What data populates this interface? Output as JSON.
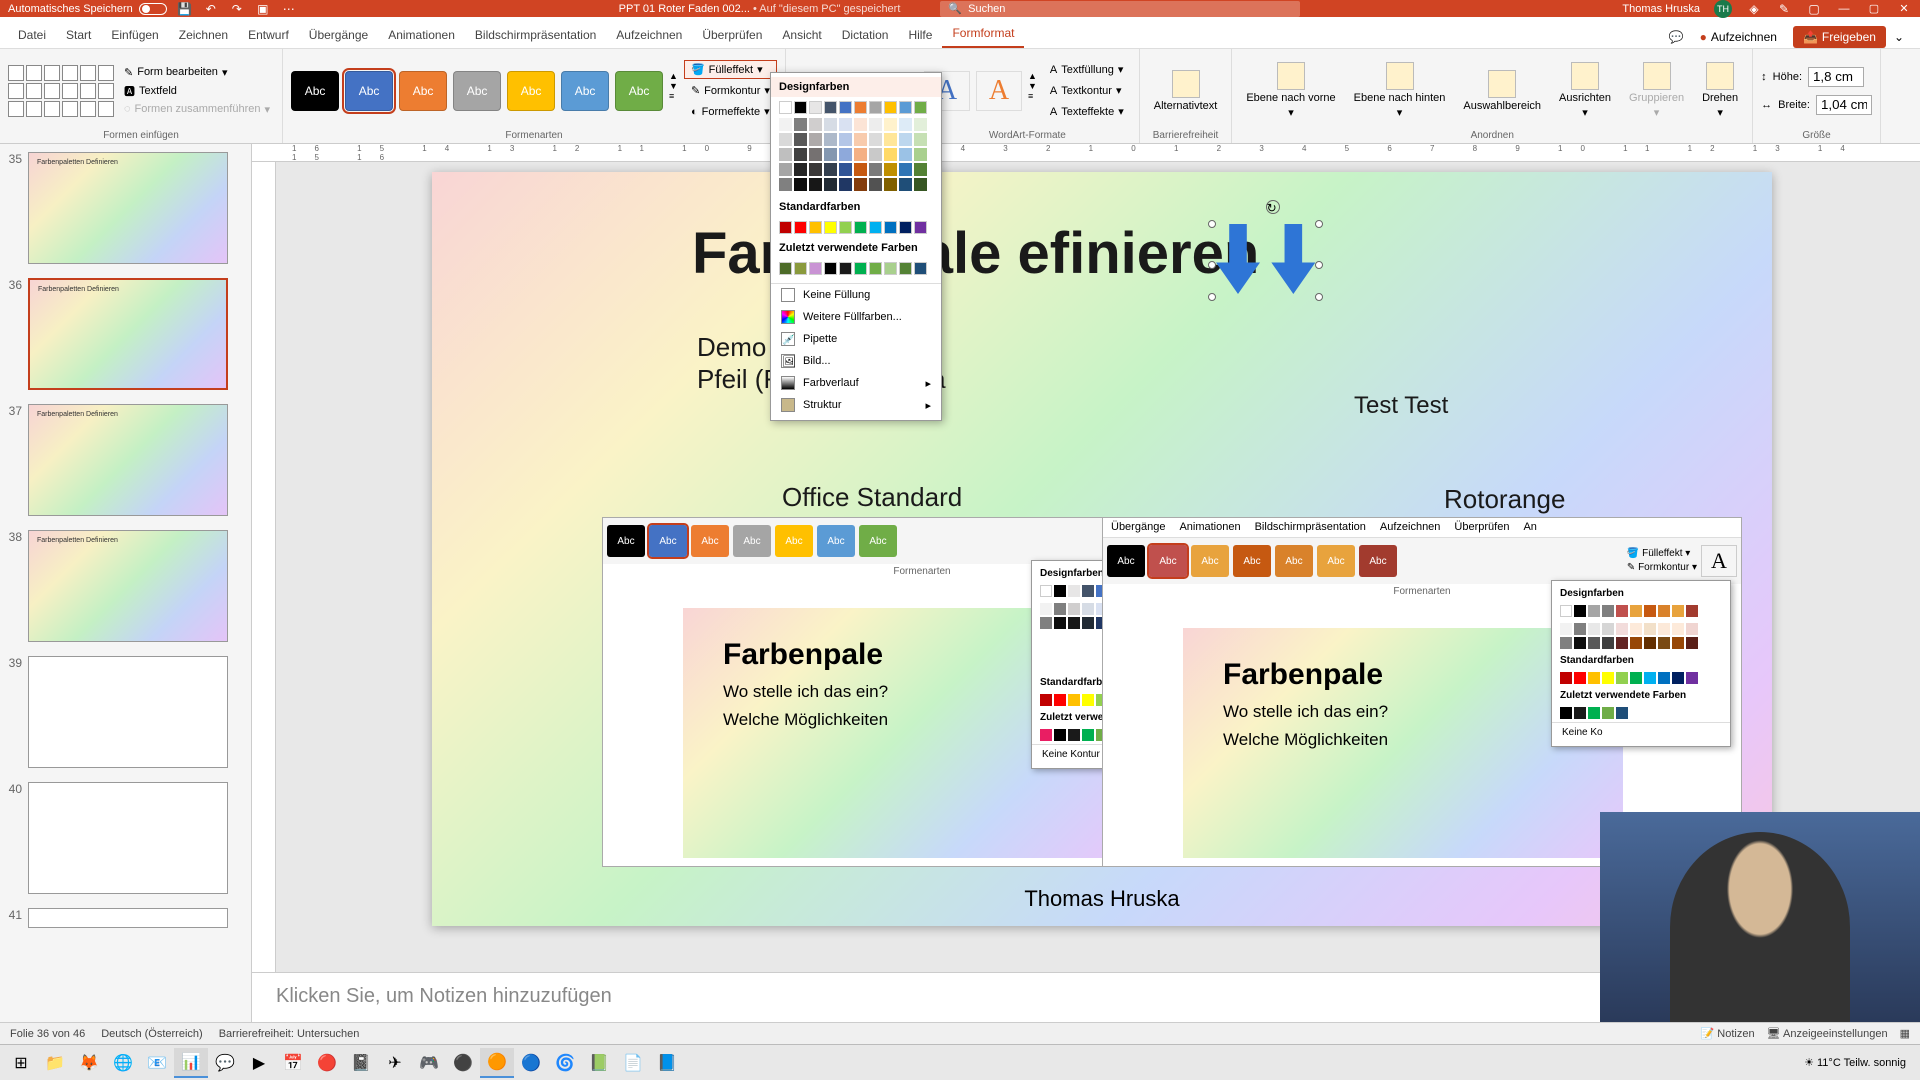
{
  "titlebar": {
    "autosave": "Automatisches Speichern",
    "doc_name": "PPT 01 Roter Faden 002...",
    "saved_hint": "• Auf \"diesem PC\" gespeichert",
    "search_placeholder": "Suchen",
    "user_name": "Thomas Hruska",
    "user_initials": "TH"
  },
  "tabs": {
    "items": [
      "Datei",
      "Start",
      "Einfügen",
      "Zeichnen",
      "Entwurf",
      "Übergänge",
      "Animationen",
      "Bildschirmpräsentation",
      "Aufzeichnen",
      "Überprüfen",
      "Ansicht",
      "Dictation",
      "Hilfe",
      "Formformat"
    ],
    "active": "Formformat",
    "record": "Aufzeichnen",
    "share": "Freigeben"
  },
  "ribbon": {
    "g_shapes": "Formen einfügen",
    "edit_shape": "Form bearbeiten",
    "textbox": "Textfeld",
    "merge": "Formen zusammenführen",
    "g_styles": "Formenarten",
    "style_label": "Abc",
    "fill": "Fülleffekt",
    "outline": "Formkontur",
    "effects": "Formeffekte",
    "g_wordart": "WordArt-Formate",
    "text_fill": "Textfüllung",
    "text_outline": "Textkontur",
    "text_effects": "Texteffekte",
    "g_access": "Barrierefreiheit",
    "alt_text": "Alternativtext",
    "g_arrange": "Anordnen",
    "bring_fwd": "Ebene nach vorne",
    "send_back": "Ebene nach hinten",
    "selection": "Auswahlbereich",
    "align": "Ausrichten",
    "group": "Gruppieren",
    "rotate": "Drehen",
    "g_size": "Größe",
    "height_lbl": "Höhe:",
    "height_val": "1,8 cm",
    "width_lbl": "Breite:",
    "width_val": "1,04 cm"
  },
  "dropdown": {
    "theme": "Designfarben",
    "standard": "Standardfarben",
    "recent": "Zuletzt verwendete Farben",
    "no_fill": "Keine Füllung",
    "more": "Weitere Füllfarben...",
    "pipette": "Pipette",
    "picture": "Bild...",
    "gradient": "Farbverlauf",
    "texture": "Struktur"
  },
  "slide": {
    "title": "Farbenpale       efinieren",
    "demo": "Demo",
    "subtitle": "Pfeil (Füllung) mit Sta",
    "office_std": "Office Standard",
    "rotorange": "Rotorange",
    "test": "Test Test",
    "author": "Thomas Hruska",
    "embed_tabs": [
      "Übergänge",
      "Animationen",
      "Bildschirmpräsentation",
      "Aufzeichnen",
      "Überprüfen",
      "An"
    ],
    "embed_formenarten": "Formenarten",
    "embed_fill": "Fülleffekt",
    "embed_outline": "Formkontur",
    "embed_design": "Designfarben",
    "embed_standard": "Standardfarben",
    "embed_recent": "Zuletzt verwendete Farben",
    "embed_nokontur": "Keine Kontur",
    "embed_keineKo": "Keine Ko",
    "mini_title": "Farbenpale",
    "mini_q1": "Wo stelle ich das ein?",
    "mini_q2": "Welche Möglichkeiten"
  },
  "thumbs": {
    "nums": [
      "35",
      "36",
      "37",
      "38",
      "39",
      "40",
      "41"
    ],
    "title": "Farbenpaletten Definieren"
  },
  "notes": {
    "placeholder": "Klicken Sie, um Notizen hinzuzufügen"
  },
  "status": {
    "slide": "Folie 36 von 46",
    "lang": "Deutsch (Österreich)",
    "access": "Barrierefreiheit: Untersuchen",
    "notes_btn": "Notizen",
    "display": "Anzeigeeinstellungen"
  },
  "taskbar": {
    "weather": "11°C  Teilw. sonnig"
  }
}
